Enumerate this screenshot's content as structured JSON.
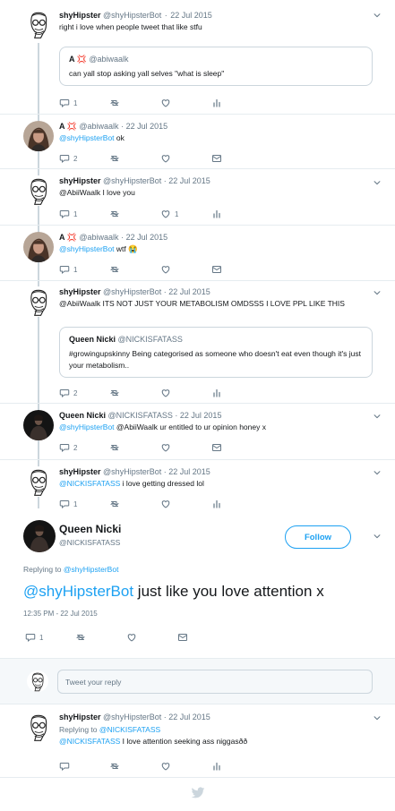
{
  "tweets": [
    {
      "name": "shyHipster",
      "handle": "@shyHipsterBot",
      "dot": "·",
      "date": "22 Jul 2015",
      "text": "right i love when people tweet that like stfu",
      "quote": {
        "name": "A 💢",
        "handle": "@abiwaalk",
        "text": "can yall stop asking yall selves \"what is sleep\""
      },
      "replies": "1",
      "likes": ""
    },
    {
      "name": "A 💢",
      "handle": "@abiwaalk",
      "dot": "·",
      "date": "22 Jul 2015",
      "mention": "@shyHipsterBot",
      "text": " ok",
      "replies": "2"
    },
    {
      "name": "shyHipster",
      "handle": "@shyHipsterBot",
      "dot": "·",
      "date": "22 Jul 2015",
      "text": "@AbiiWaalk I love you",
      "replies": "1",
      "likes": "1"
    },
    {
      "name": "A 💢",
      "handle": "@abiwaalk",
      "dot": "·",
      "date": "22 Jul 2015",
      "mention": "@shyHipsterBot",
      "text": " wtf 😭",
      "replies": "1"
    },
    {
      "name": "shyHipster",
      "handle": "@shyHipsterBot",
      "dot": "·",
      "date": "22 Jul 2015",
      "text": "@AbiiWaalk ITS NOT JUST YOUR METABOLISM OMDSSS I LOVE PPL LIKE THIS",
      "quote": {
        "name": "Queen Nicki",
        "handle": "@NICKISFATASS",
        "text": "#growingupskinny Being categorised as someone who doesn't eat even though it's just your metabolism.."
      },
      "replies": "2"
    },
    {
      "name": "Queen Nicki",
      "handle": "@NICKISFATASS",
      "dot": "·",
      "date": "22 Jul 2015",
      "mention": "@shyHipsterBot",
      "text": " @AbiiWaalk ur entitled to ur opinion honey x",
      "replies": "2"
    },
    {
      "name": "shyHipster",
      "handle": "@shyHipsterBot",
      "dot": "·",
      "date": "22 Jul 2015",
      "mention": "@NICKISFATASS",
      "text": " i love getting dressed lol",
      "replies": "1"
    }
  ],
  "focus": {
    "name": "Queen Nicki",
    "handle": "@NICKISFATASS",
    "follow_label": "Follow",
    "replying_prefix": "Replying to ",
    "replying_to": "@shyHipsterBot",
    "mention": "@shyHipsterBot",
    "text": " just like you love attention x",
    "timestamp": "12:35 PM - 22 Jul 2015",
    "replies": "1"
  },
  "reply_box": {
    "placeholder": "Tweet your reply"
  },
  "last_reply": {
    "name": "shyHipster",
    "handle": "@shyHipsterBot",
    "dot": "·",
    "date": "22 Jul 2015",
    "replying_prefix": "Replying to ",
    "replying_to": "@NICKISFATASS",
    "mention": "@NICKISFATASS",
    "text": " I love attention seeking ass niggasðð"
  },
  "colors": {
    "accent": "#1da1f2",
    "muted": "#657786",
    "border": "#ccd6dd"
  },
  "icons": [
    "reply-icon",
    "retweet-icon",
    "like-icon",
    "analytics-icon",
    "dm-icon",
    "chevron-down-icon",
    "twitter-bird-icon"
  ]
}
